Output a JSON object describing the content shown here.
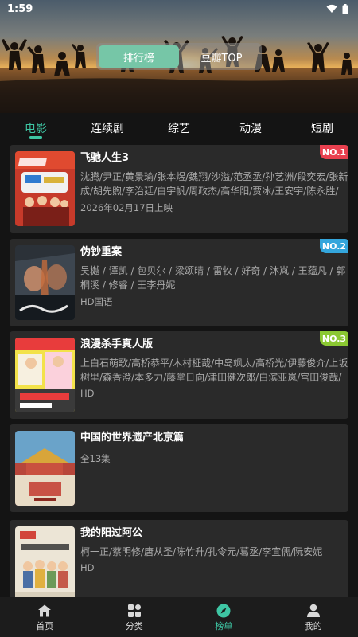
{
  "status_bar": {
    "time": "1:59"
  },
  "header": {
    "toggle": [
      {
        "label": "排行榜",
        "active": true
      },
      {
        "label": "豆瓣TOP",
        "active": false
      }
    ]
  },
  "tabs": [
    {
      "label": "电影",
      "active": true
    },
    {
      "label": "连续剧",
      "active": false
    },
    {
      "label": "综艺",
      "active": false
    },
    {
      "label": "动漫",
      "active": false
    },
    {
      "label": "短剧",
      "active": false
    }
  ],
  "items": [
    {
      "title": "飞驰人生3",
      "cast": "沈腾/尹正/黄景瑜/张本煜/魏翔/沙溢/范丞丞/孙艺洲/段奕宏/张新成/胡先煦/李治廷/白宇帆/周政杰/高华阳/贾冰/王安宇/陈永胜/",
      "meta": "2026年02月17日上映",
      "badge": "NO.1",
      "badge_color": "#e9404f"
    },
    {
      "title": "伪钞重案",
      "cast": "吴樾 / 谭凯 / 包贝尔 / 梁颂晴 / 雷牧 / 好奇 / 沐岚 / 王蕴凡 / 郭桐溪 / 修睿 / 王李丹妮",
      "meta": "HD国语",
      "badge": "NO.2",
      "badge_color": "#34a6dc"
    },
    {
      "title": "浪漫杀手真人版",
      "cast": "上白石萌歌/高桥恭平/木村柾哉/中岛飒太/高桥光/伊藤俊介/上坂树里/森香澄/本多力/藤堂日向/津田健次郎/白滨亚岚/宫田俊哉/",
      "meta": "HD",
      "badge": "NO.3",
      "badge_color": "#8bc832"
    },
    {
      "title": "中国的世界遗产北京篇",
      "cast": "",
      "meta": "全13集",
      "badge": "",
      "badge_color": ""
    },
    {
      "title": "我的阳过阿公",
      "cast": "柯一正/蔡明修/唐从圣/陈竹升/孔令元/葛丞/李宜儒/阮安妮",
      "meta": "HD",
      "badge": "",
      "badge_color": ""
    }
  ],
  "bottom_nav": [
    {
      "label": "首页",
      "icon": "home-icon",
      "active": false
    },
    {
      "label": "分类",
      "icon": "grid-icon",
      "active": false
    },
    {
      "label": "榜单",
      "icon": "compass-icon",
      "active": true
    },
    {
      "label": "我的",
      "icon": "person-icon",
      "active": false
    }
  ]
}
